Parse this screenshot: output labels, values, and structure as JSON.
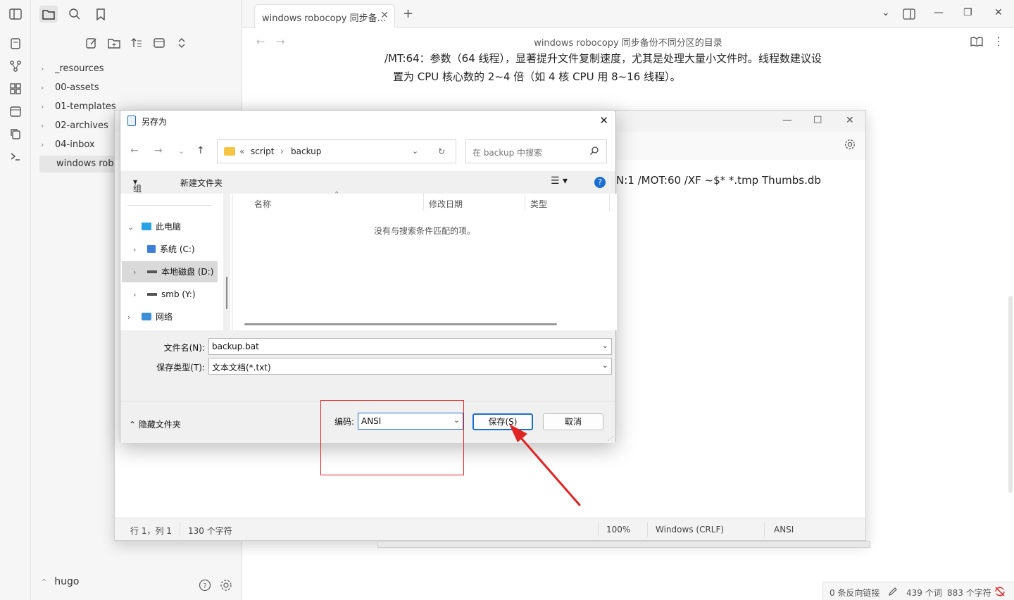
{
  "sidebar": {
    "tree": [
      {
        "label": "_resources"
      },
      {
        "label": "00-assets"
      },
      {
        "label": "01-templates"
      },
      {
        "label": "02-archives"
      },
      {
        "label": "04-inbox"
      }
    ],
    "active_file": "windows robocopy 同步备份不同分区的目录",
    "vault_name": "hugo"
  },
  "tabs": {
    "active_label": "windows robocopy 同步备...",
    "close_glyph": "✕",
    "new_glyph": "+"
  },
  "note": {
    "title": "windows robocopy 同步备份不同分区的目录",
    "line1": "/MT:64：参数（64 线程），显著提升文件复制速度，尤其是处理大量小文件时。线程数建议设",
    "line2": "置为 CPU 核心数的 2~4 倍（如 4 核 CPU 用 8~16 线程）。"
  },
  "notepad": {
    "code_line": "N:1 /MOT:60 /XF ~$* *.tmp Thumbs.db",
    "status": {
      "position": "行 1，列 1",
      "chars": "130 个字符",
      "zoom": "100%",
      "eol": "Windows (CRLF)",
      "encoding": "ANSI"
    }
  },
  "dialog": {
    "title": "另存为",
    "path": {
      "prefix": "«",
      "crumb1": "script",
      "crumb2": "backup"
    },
    "search_placeholder": "在 backup 中搜索",
    "toolbar": {
      "organize": "组织",
      "new_folder": "新建文件夹"
    },
    "nav_tree": {
      "this_pc": "此电脑",
      "drive_c": "系统 (C:)",
      "drive_d": "本地磁盘 (D:)",
      "drive_y": "smb (Y:)",
      "network": "网络"
    },
    "columns": {
      "name": "名称",
      "modified": "修改日期",
      "type": "类型"
    },
    "empty_message": "没有与搜索条件匹配的项。",
    "filename_label": "文件名(N):",
    "filename_value": "backup.bat",
    "filetype_label": "保存类型(T):",
    "filetype_value": "文本文档(*.txt)",
    "hide_folders": "隐藏文件夹",
    "encoding_label": "编码:",
    "encoding_value": "ANSI",
    "save_button": "保存(S)",
    "cancel_button": "取消"
  },
  "statusbar": {
    "backlinks": "0 条反向链接",
    "words": "439 个词",
    "chars": "883 个字符"
  },
  "colors": {
    "accent": "#1a6fd1",
    "annotation_red": "#e02424"
  }
}
